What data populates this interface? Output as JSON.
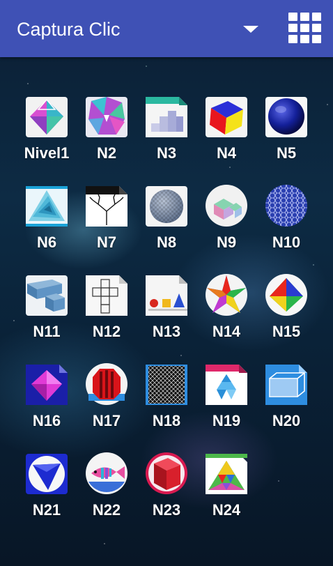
{
  "app_bar": {
    "title": "Captura Clic",
    "dropdown_icon": "dropdown-arrow-icon",
    "grid_icon": "grid-view-icon"
  },
  "apps": [
    {
      "label": "Nivel1",
      "icon": "octahedron-icon"
    },
    {
      "label": "N2",
      "icon": "stellated-polyhedron-icon"
    },
    {
      "label": "N3",
      "icon": "stepped-blocks-icon"
    },
    {
      "label": "N4",
      "icon": "colored-cube-icon"
    },
    {
      "label": "N5",
      "icon": "blue-sphere-icon"
    },
    {
      "label": "N6",
      "icon": "spiral-triangle-icon"
    },
    {
      "label": "N7",
      "icon": "fractal-tree-icon"
    },
    {
      "label": "N8",
      "icon": "checkered-sphere-icon"
    },
    {
      "label": "N9",
      "icon": "isometric-stairs-icon"
    },
    {
      "label": "N10",
      "icon": "hexagon-pattern-icon"
    },
    {
      "label": "N11",
      "icon": "block-shapes-icon"
    },
    {
      "label": "N12",
      "icon": "cube-net-icon"
    },
    {
      "label": "N13",
      "icon": "geometric-solids-icon"
    },
    {
      "label": "N14",
      "icon": "star-polyhedron-icon"
    },
    {
      "label": "N15",
      "icon": "colored-octahedron-icon"
    },
    {
      "label": "N16",
      "icon": "magenta-octahedron-icon"
    },
    {
      "label": "N17",
      "icon": "red-prism-icon"
    },
    {
      "label": "N18",
      "icon": "pattern-strip-icon"
    },
    {
      "label": "N19",
      "icon": "triangle-mosaic-icon"
    },
    {
      "label": "N20",
      "icon": "wireframe-box-icon"
    },
    {
      "label": "N21",
      "icon": "blue-tetrahedron-icon"
    },
    {
      "label": "N22",
      "icon": "fish-icon"
    },
    {
      "label": "N23",
      "icon": "red-cube-icon"
    },
    {
      "label": "N24",
      "icon": "tangram-icon"
    }
  ]
}
